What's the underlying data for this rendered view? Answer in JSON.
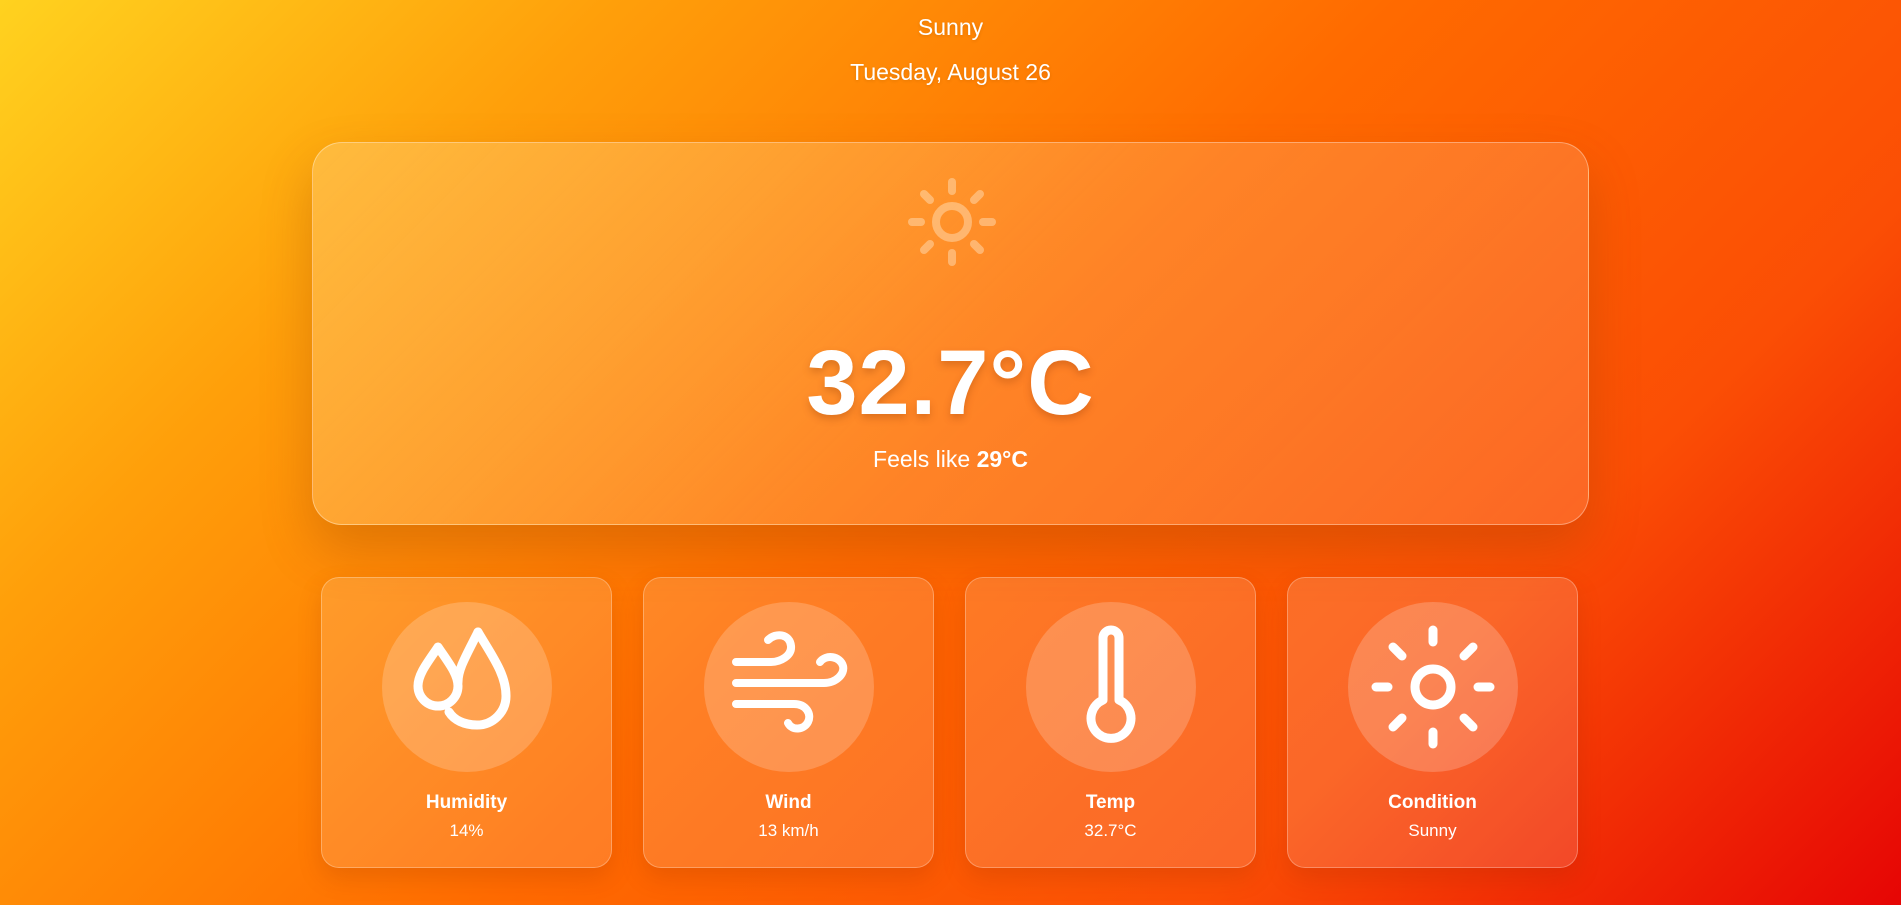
{
  "header": {
    "condition": "Sunny",
    "date": "Tuesday, August 26"
  },
  "current": {
    "icon": "sun-icon",
    "temperature": "32.7°C",
    "feels_like_prefix": "Feels like",
    "feels_like_value": "29°C"
  },
  "stats": [
    {
      "icon": "humidity-icon",
      "label": "Humidity",
      "value": "14%"
    },
    {
      "icon": "wind-icon",
      "label": "Wind",
      "value": "13 km/h"
    },
    {
      "icon": "thermometer-icon",
      "label": "Temp",
      "value": "32.7°C"
    },
    {
      "icon": "sun-icon",
      "label": "Condition",
      "value": "Sunny"
    }
  ],
  "colors": {
    "gradient_start": "#ffd21f",
    "gradient_mid": "#ff6a00",
    "gradient_end": "#e60505",
    "text": "#ffffff"
  }
}
